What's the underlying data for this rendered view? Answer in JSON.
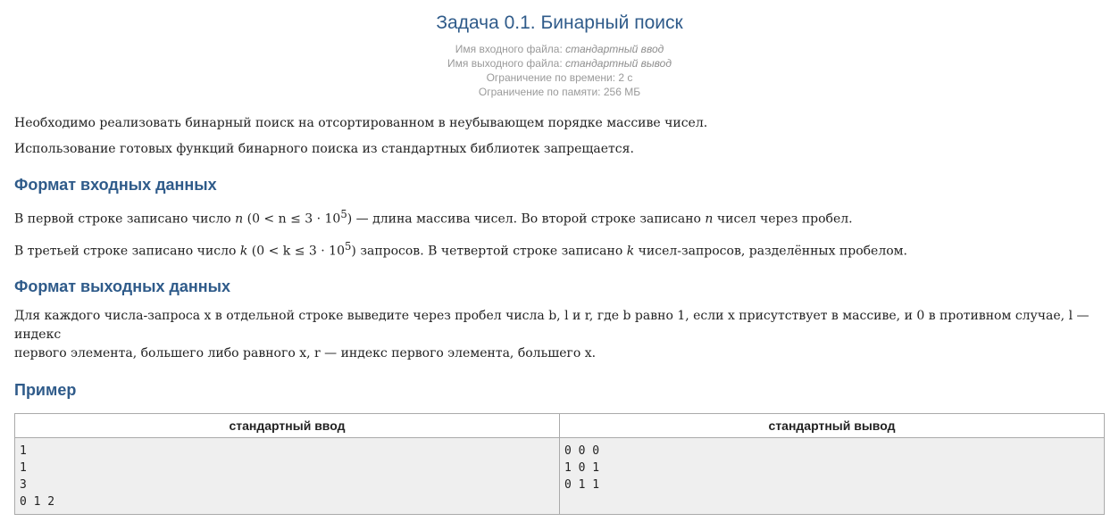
{
  "problem": {
    "title": "Задача 0.1. Бинарный поиск",
    "meta": {
      "input_label": "Имя входного файла:",
      "input_value": "стандартный ввод",
      "output_label": "Имя выходного файла:",
      "output_value": "стандартный вывод",
      "time_limit": "Ограничение по времени: 2 с",
      "memory_limit": "Ограничение по памяти: 256 МБ"
    },
    "statement": {
      "p1": "Необходимо реализовать бинарный поиск на отсортированном в неубывающем порядке массиве чисел.",
      "p2": "Использование готовых функций бинарного поиска из стандартных библиотек запрещается."
    },
    "input_format": {
      "heading": "Формат входных данных",
      "p1_a": "В первой строке записано число ",
      "p1_var": "n",
      "p1_math": " (0 < n ≤ 3 · 10",
      "p1_sup": "5",
      "p1_b": ") — длина массива чисел. Во второй строке записано ",
      "p1_var2": "n",
      "p1_c": " чисел через пробел.",
      "p2_a": "В третьей строке записано число ",
      "p2_var": "k",
      "p2_math": " (0 < k ≤ 3 · 10",
      "p2_sup": "5",
      "p2_b": ") запросов. В четвертой строке записано ",
      "p2_var2": "k",
      "p2_c": " чисел-запросов, разделённых пробелом."
    },
    "output_format": {
      "heading": "Формат выходных данных",
      "line1": "Для каждого числа-запроса x в отдельной строке выведите через пробел числа b, l и r, где b равно 1, если x присутствует в массиве, и 0 в противном случае, l — индекс",
      "line2": "первого элемента, большего либо равного x, r — индекс первого элемента, большего x."
    },
    "example": {
      "heading": "Пример",
      "col_input": "стандартный ввод",
      "col_output": "стандартный вывод",
      "input_lines": [
        "1",
        "1",
        "3",
        "0 1 2"
      ],
      "output_lines": [
        "0 0 0",
        "1 0 1",
        "0 1 1"
      ]
    }
  }
}
